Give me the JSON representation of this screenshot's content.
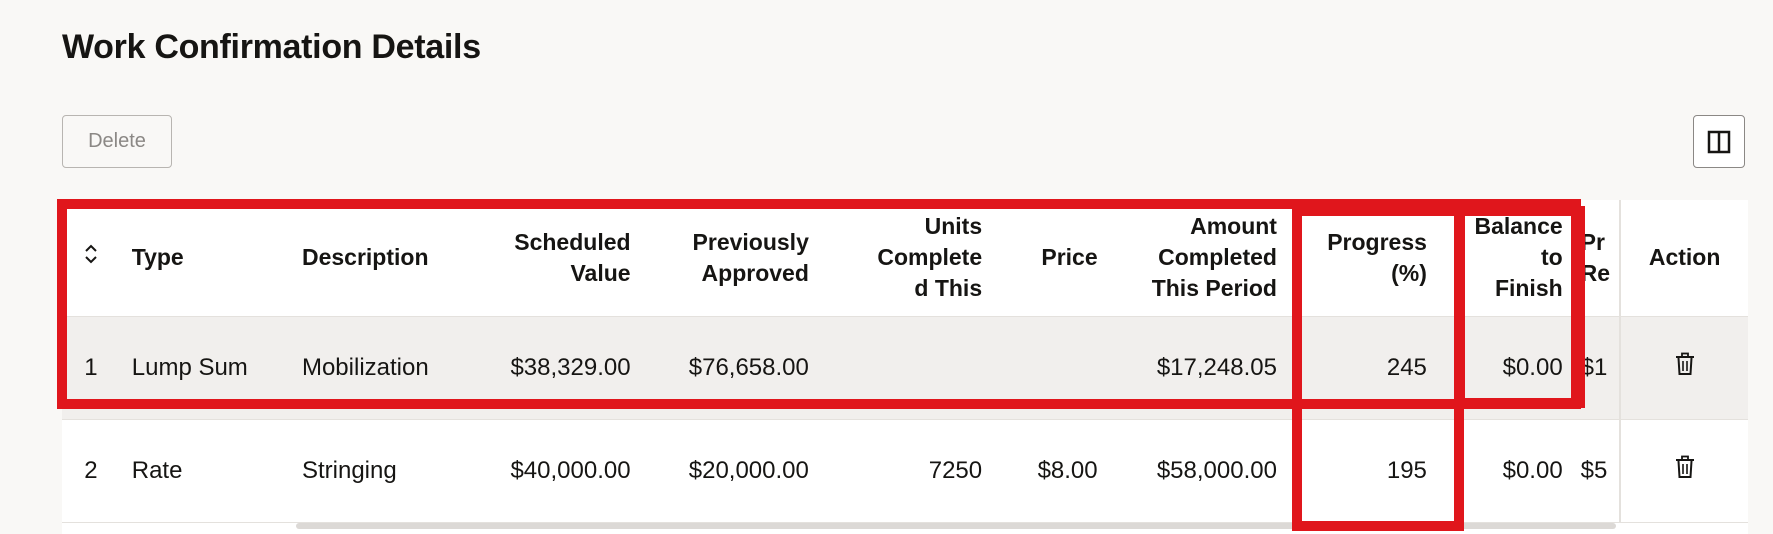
{
  "page": {
    "title": "Work Confirmation Details"
  },
  "toolbar": {
    "delete_label": "Delete",
    "columns_icon": "columns-panel-icon"
  },
  "table": {
    "headers": {
      "sort": "sort-icon",
      "type": "Type",
      "description": "Description",
      "scheduled_value": "Scheduled Value",
      "previously_approved": "Previously Approved",
      "units_completed": "Units Completed This",
      "price": "Price",
      "amount_completed": "Amount Completed This Period",
      "progress": "Progress (%)",
      "balance": "Balance to Finish",
      "pr_re": "Pr Re",
      "action": "Action"
    },
    "rows": [
      {
        "num": "1",
        "type": "Lump Sum",
        "description": "Mobilization",
        "scheduled_value": "$38,329.00",
        "previously_approved": "$76,658.00",
        "units_completed": "",
        "price": "",
        "amount_completed": "$17,248.05",
        "progress": "245",
        "balance": "$0.00",
        "pr_re": "$1",
        "action_icon": "delete-icon"
      },
      {
        "num": "2",
        "type": "Rate",
        "description": "Stringing",
        "scheduled_value": "$40,000.00",
        "previously_approved": "$20,000.00",
        "units_completed": "7250",
        "price": "$8.00",
        "amount_completed": "$58,000.00",
        "progress": "195",
        "balance": "$0.00",
        "pr_re": "$5",
        "action_icon": "delete-icon"
      }
    ]
  },
  "colors": {
    "highlight": "#e0161c",
    "row_alt": "#f1efed",
    "text": "#161513"
  }
}
